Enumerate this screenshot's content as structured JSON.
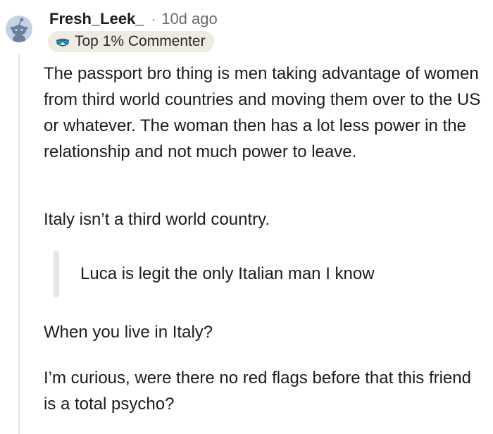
{
  "comment": {
    "author": {
      "username": "Fresh_Leek_",
      "separator": "·",
      "timestamp": "10d ago",
      "avatar_icon": "snoo-avatar-icon"
    },
    "flair": {
      "icon": "sunglasses-face-icon",
      "label": "Top 1% Commenter"
    },
    "body": {
      "paragraphs": [
        "The passport bro thing is men taking advantage of women from third world countries and moving them over to the US or whatever. The woman then has a lot less power in the relationship and not much power to leave.",
        "Italy isn’t a third world country.",
        "When you live in Italy?",
        "I’m curious, were there no red flags before that this friend is a total psycho?"
      ],
      "quote": "Luca is legit the only Italian man I know"
    }
  }
}
